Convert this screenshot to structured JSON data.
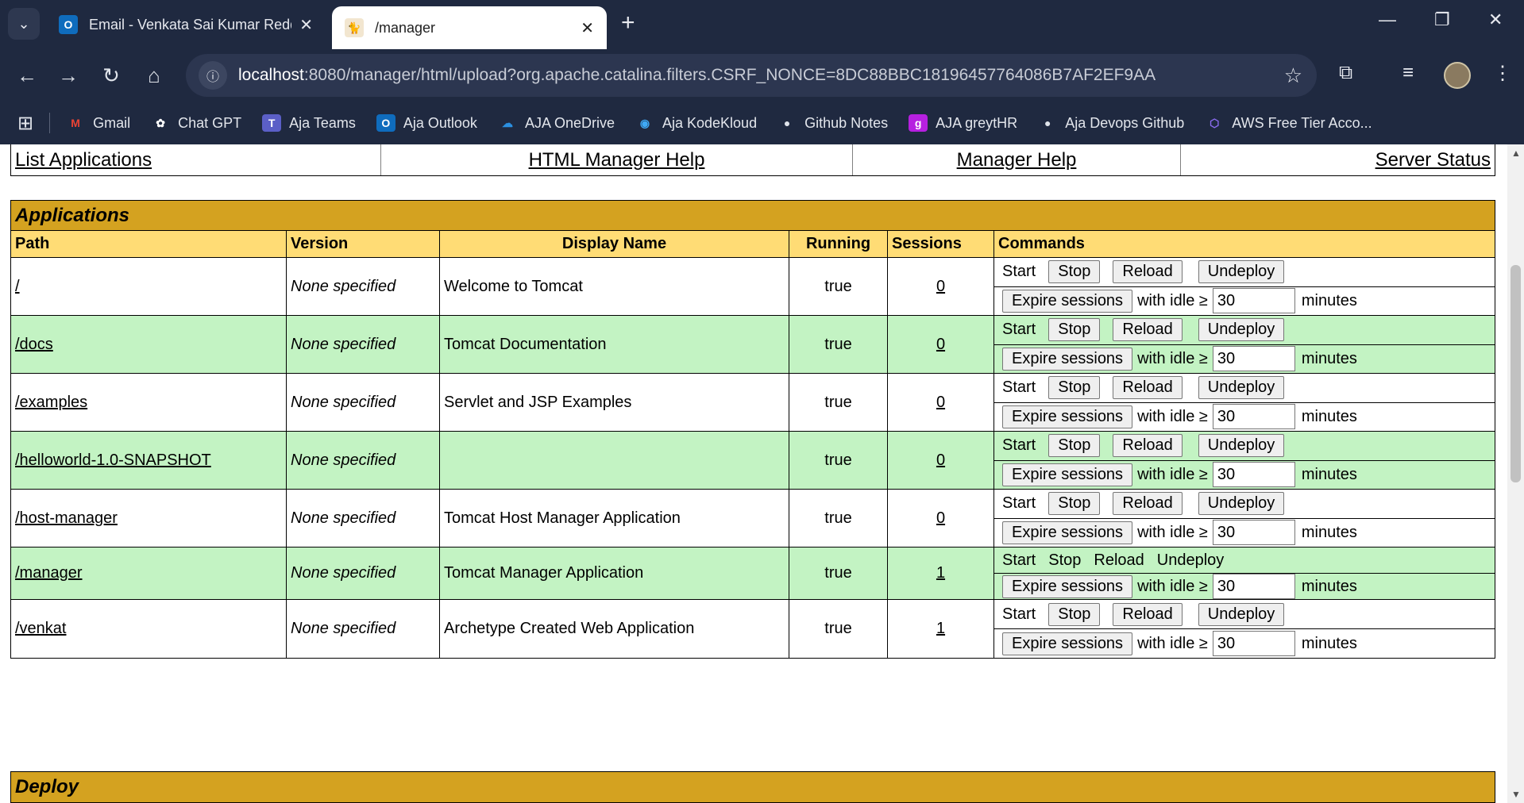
{
  "browser": {
    "tabs": [
      {
        "title": "Email - Venkata Sai Kumar Redd",
        "favicon": "outlook-icon",
        "active": false
      },
      {
        "title": "/manager",
        "favicon": "tomcat-icon",
        "active": true
      }
    ],
    "url_host": "localhost",
    "url_rest": ":8080/manager/html/upload?org.apache.catalina.filters.CSRF_NONCE=8DC88BBC18196457764086B7AF2EF9AA",
    "bookmarks": [
      {
        "label": "Gmail",
        "icon": "gmail-icon"
      },
      {
        "label": "Chat GPT",
        "icon": "chatgpt-icon"
      },
      {
        "label": "Aja Teams",
        "icon": "teams-icon"
      },
      {
        "label": "Aja Outlook",
        "icon": "outlook-icon"
      },
      {
        "label": "AJA OneDrive",
        "icon": "onedrive-icon"
      },
      {
        "label": "Aja KodeKloud",
        "icon": "kodekloud-icon"
      },
      {
        "label": "Github Notes",
        "icon": "github-icon"
      },
      {
        "label": "AJA greytHR",
        "icon": "greythr-icon"
      },
      {
        "label": "Aja Devops Github",
        "icon": "github-icon"
      },
      {
        "label": "AWS Free Tier Acco...",
        "icon": "aws-icon"
      }
    ]
  },
  "links": {
    "list_applications": "List Applications",
    "html_manager_help": "HTML Manager Help",
    "manager_help": "Manager Help",
    "server_status": "Server Status"
  },
  "applications": {
    "title": "Applications",
    "headers": {
      "path": "Path",
      "version": "Version",
      "display_name": "Display Name",
      "running": "Running",
      "sessions": "Sessions",
      "commands": "Commands"
    },
    "command_labels": {
      "start": "Start",
      "stop": "Stop",
      "reload": "Reload",
      "undeploy": "Undeploy",
      "expire": "Expire sessions",
      "with_idle": "with idle ≥",
      "minutes": "minutes"
    },
    "rows": [
      {
        "path": "/",
        "version": "None specified",
        "display_name": "Welcome to Tomcat",
        "running": "true",
        "sessions": "0",
        "idle": "30"
      },
      {
        "path": "/docs",
        "version": "None specified",
        "display_name": "Tomcat Documentation",
        "running": "true",
        "sessions": "0",
        "idle": "30"
      },
      {
        "path": "/examples",
        "version": "None specified",
        "display_name": "Servlet and JSP Examples",
        "running": "true",
        "sessions": "0",
        "idle": "30"
      },
      {
        "path": "/helloworld-1.0-SNAPSHOT",
        "version": "None specified",
        "display_name": "",
        "running": "true",
        "sessions": "0",
        "idle": "30"
      },
      {
        "path": "/host-manager",
        "version": "None specified",
        "display_name": "Tomcat Host Manager Application",
        "running": "true",
        "sessions": "0",
        "idle": "30"
      },
      {
        "path": "/manager",
        "version": "None specified",
        "display_name": "Tomcat Manager Application",
        "running": "true",
        "sessions": "1",
        "idle": "30"
      },
      {
        "path": "/venkat",
        "version": "None specified",
        "display_name": "Archetype Created Web Application",
        "running": "true",
        "sessions": "1",
        "idle": "30"
      }
    ]
  },
  "deploy": {
    "title": "Deploy"
  },
  "colors": {
    "section_header": "#d4a220",
    "column_header": "#ffdc75",
    "odd_row": "#c3f3c3",
    "browser_chrome": "#1f2940"
  }
}
